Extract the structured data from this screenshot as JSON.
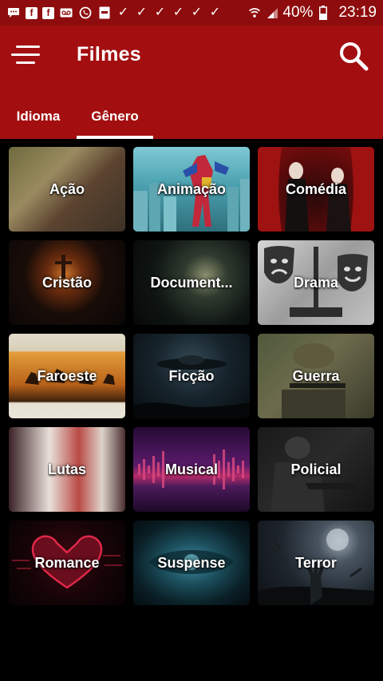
{
  "status_bar": {
    "left_icons": [
      "chat-bubble-icon",
      "facebook-icon",
      "facebook-icon",
      "voicemail-icon",
      "whatsapp-icon",
      "image-icon",
      "check-icon",
      "check-icon",
      "check-icon",
      "check-icon",
      "check-icon",
      "check-icon"
    ],
    "battery": "40%",
    "time": "23:19"
  },
  "app_bar": {
    "title": "Filmes",
    "background": "#a30e10",
    "status_background": "#8e0c0d"
  },
  "tabs": [
    {
      "label": "Idioma",
      "selected": false
    },
    {
      "label": "Gênero",
      "selected": true
    }
  ],
  "genres": [
    {
      "label": "Ação"
    },
    {
      "label": "Animação"
    },
    {
      "label": "Comédia"
    },
    {
      "label": "Cristão"
    },
    {
      "label": "Document..."
    },
    {
      "label": "Drama"
    },
    {
      "label": "Faroeste"
    },
    {
      "label": "Ficção"
    },
    {
      "label": "Guerra"
    },
    {
      "label": "Lutas"
    },
    {
      "label": "Musical"
    },
    {
      "label": "Policial"
    },
    {
      "label": "Romance"
    },
    {
      "label": "Suspense"
    },
    {
      "label": "Terror"
    }
  ]
}
